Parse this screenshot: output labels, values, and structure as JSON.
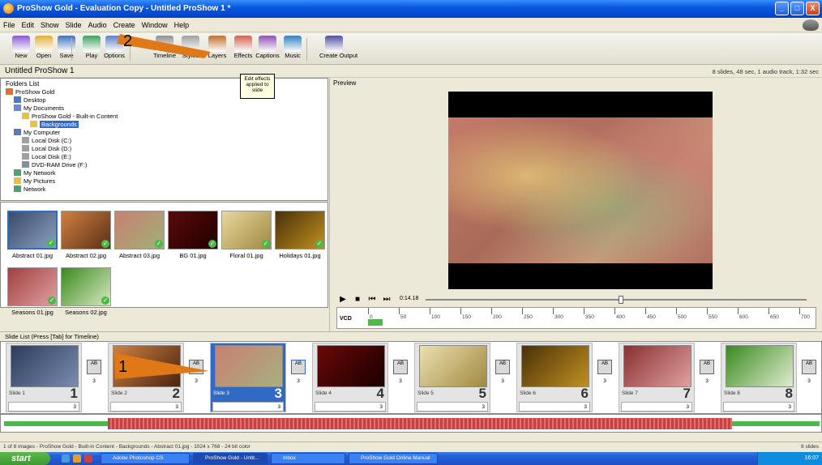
{
  "window": {
    "title": "ProShow Gold - Evaluation Copy - Untitled ProShow 1 *",
    "controls": [
      "_",
      "□",
      "X"
    ]
  },
  "menu": [
    "File",
    "Edit",
    "Show",
    "Slide",
    "Audio",
    "Create",
    "Window",
    "Help"
  ],
  "toolbar": [
    {
      "label": "New",
      "icon": "new-show-icon"
    },
    {
      "label": "Open",
      "icon": "open-folder-icon"
    },
    {
      "label": "Save",
      "icon": "save-disk-icon"
    },
    {
      "label": "Play",
      "icon": "play-icon"
    },
    {
      "label": "Options",
      "icon": "options-icon"
    },
    {
      "label": "Timeline",
      "icon": "timeline-icon"
    },
    {
      "label": "Styles",
      "icon": "styles-icon"
    },
    {
      "label": "Layers",
      "icon": "layers-icon"
    },
    {
      "label": "Effects",
      "icon": "effects-icon"
    },
    {
      "label": "Captions",
      "icon": "captions-icon"
    },
    {
      "label": "Music",
      "icon": "music-icon"
    },
    {
      "label": "Create Output",
      "icon": "create-output-icon"
    }
  ],
  "show": {
    "title": "Untitled ProShow 1",
    "info": "8 slides, 48 sec, 1 audio track, 1:32 sec"
  },
  "tooltip": "Edit effects applied to slide",
  "folders": {
    "title": "Folders List",
    "items": [
      {
        "label": "ProShow Gold",
        "indent": 0,
        "icon": "app-icon"
      },
      {
        "label": "Desktop",
        "indent": 1,
        "icon": "desktop-icon"
      },
      {
        "label": "My Documents",
        "indent": 1,
        "icon": "documents-icon"
      },
      {
        "label": "ProShow Gold - Built-in Content",
        "indent": 2,
        "icon": "folder-icon"
      },
      {
        "label": "Backgrounds",
        "indent": 3,
        "icon": "folder-icon",
        "selected": true
      },
      {
        "label": "My Computer",
        "indent": 1,
        "icon": "computer-icon"
      },
      {
        "label": "Local Disk (C:)",
        "indent": 2,
        "icon": "drive-icon"
      },
      {
        "label": "Local Disk (D:)",
        "indent": 2,
        "icon": "drive-icon"
      },
      {
        "label": "Local Disk (E:)",
        "indent": 2,
        "icon": "drive-icon"
      },
      {
        "label": "DVD-RAM Drive (F:)",
        "indent": 2,
        "icon": "dvd-icon"
      },
      {
        "label": "My Network",
        "indent": 1,
        "icon": "network-icon"
      },
      {
        "label": "My Pictures",
        "indent": 1,
        "icon": "pictures-icon"
      },
      {
        "label": "Network",
        "indent": 1,
        "icon": "network-icon"
      }
    ]
  },
  "files": [
    {
      "name": "Abstract 01.jpg",
      "colors": [
        "#3a4a6a",
        "#8aa0c0"
      ],
      "selected": true
    },
    {
      "name": "Abstract 02.jpg",
      "colors": [
        "#d08040",
        "#5a3018"
      ]
    },
    {
      "name": "Abstract 03.jpg",
      "colors": [
        "#c88070",
        "#a0b078"
      ]
    },
    {
      "name": "BG 01.jpg",
      "colors": [
        "#5a0a0a",
        "#200000"
      ]
    },
    {
      "name": "Floral 01.jpg",
      "colors": [
        "#e8d8a0",
        "#a08a40"
      ]
    },
    {
      "name": "Holidays 01.jpg",
      "colors": [
        "#4a3008",
        "#c09020"
      ]
    },
    {
      "name": "Seasons 01.jpg",
      "colors": [
        "#a04040",
        "#e0a0a0"
      ]
    },
    {
      "name": "Seasons 02.jpg",
      "colors": [
        "#3a8a20",
        "#d8e8c0"
      ]
    }
  ],
  "preview": {
    "title": "Preview",
    "time": "0:14.18",
    "vcd_label": "VCD",
    "ruler_labels": [
      "0",
      "50",
      "100",
      "150",
      "200",
      "250",
      "300",
      "350",
      "400",
      "450",
      "500",
      "550",
      "600",
      "650",
      "700"
    ]
  },
  "slides_header": "Slide List (Press [Tab] for Timeline)",
  "slides": [
    {
      "name": "Slide 1",
      "num": "1",
      "dur": "3",
      "trans_time": "3",
      "colors": [
        "#2c3c5c",
        "#7a8cb0"
      ]
    },
    {
      "name": "Slide 2",
      "num": "2",
      "dur": "3",
      "trans_time": "3",
      "colors": [
        "#d08040",
        "#4a2410"
      ]
    },
    {
      "name": "Slide 3",
      "num": "3",
      "dur": "3",
      "trans_time": "3",
      "colors": [
        "#c88070",
        "#a8b080"
      ],
      "selected": true
    },
    {
      "name": "Slide 4",
      "num": "4",
      "dur": "3",
      "trans_time": "3",
      "colors": [
        "#6a0808",
        "#1a0000"
      ]
    },
    {
      "name": "Slide 5",
      "num": "5",
      "dur": "3",
      "trans_time": "3",
      "colors": [
        "#ece0b0",
        "#a08a40"
      ]
    },
    {
      "name": "Slide 6",
      "num": "6",
      "dur": "3",
      "trans_time": "3",
      "colors": [
        "#4a3008",
        "#c09020"
      ]
    },
    {
      "name": "Slide 7",
      "num": "7",
      "dur": "3",
      "trans_time": "3",
      "colors": [
        "#8a3030",
        "#e0a0a0"
      ]
    },
    {
      "name": "Slide 8",
      "num": "8",
      "dur": "3",
      "trans_time": "3",
      "colors": [
        "#3a8a20",
        "#e0ecd0"
      ]
    }
  ],
  "transition_label": "AB",
  "status": {
    "left": "1 of 8 images - ProShow Gold - Built-in Content - Backgrounds - Abstract 01.jpg - 1024 x 768 - 24 bit color",
    "right": "8 slides"
  },
  "taskbar": {
    "start": "start",
    "buttons": [
      "Adobe Photoshop CS",
      "ProShow Gold - Untit...",
      "Inbox",
      "ProShow Gold Online Manual"
    ],
    "clock": "16:07"
  },
  "annotations": [
    "1",
    "2"
  ]
}
